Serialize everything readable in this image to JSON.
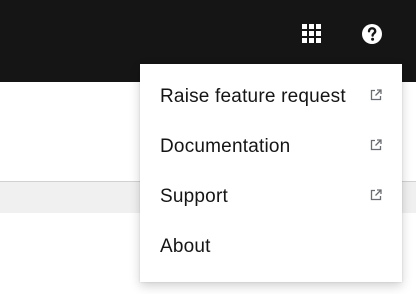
{
  "masthead": {
    "background": "#151515",
    "apps_icon": "grid-apps-icon",
    "help_icon": "question-circle-icon"
  },
  "help_menu": {
    "items": [
      {
        "label": "Raise feature request",
        "icon": "external-link-icon"
      },
      {
        "label": "Documentation",
        "icon": "external-link-icon"
      },
      {
        "label": "Support",
        "icon": "external-link-icon"
      },
      {
        "label": "About"
      }
    ]
  }
}
